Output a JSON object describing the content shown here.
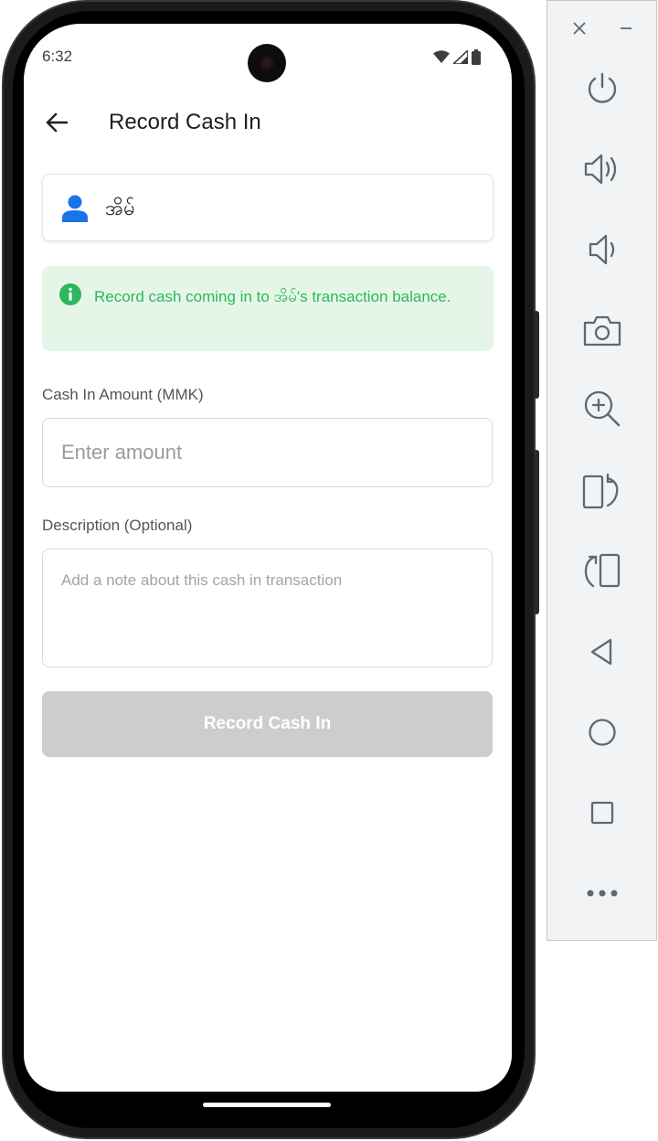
{
  "status_bar": {
    "time": "6:32"
  },
  "header": {
    "title": "Record Cash In",
    "back_icon": "arrow-back-icon"
  },
  "user_card": {
    "name": "အိမ်",
    "icon": "person-icon",
    "icon_color": "#1a73e8"
  },
  "info_banner": {
    "icon": "info-icon",
    "text": "Record cash coming in to အိမ်'s transaction balance.",
    "text_color": "#2db75a",
    "background": "#e5f6e9"
  },
  "form": {
    "amount_label": "Cash In Amount (MMK)",
    "amount_placeholder": "Enter amount",
    "description_label": "Description (Optional)",
    "description_placeholder": "Add a note about this cash in transaction",
    "submit_label": "Record Cash In",
    "submit_enabled": false
  },
  "emulator_toolbar": {
    "window_controls": [
      "close-icon",
      "minimize-icon"
    ],
    "buttons": [
      "power-icon",
      "volume-up-icon",
      "volume-down-icon",
      "camera-icon",
      "zoom-in-icon",
      "rotate-left-icon",
      "rotate-right-icon",
      "back-triangle-icon",
      "home-circle-icon",
      "overview-square-icon",
      "more-icon"
    ]
  }
}
